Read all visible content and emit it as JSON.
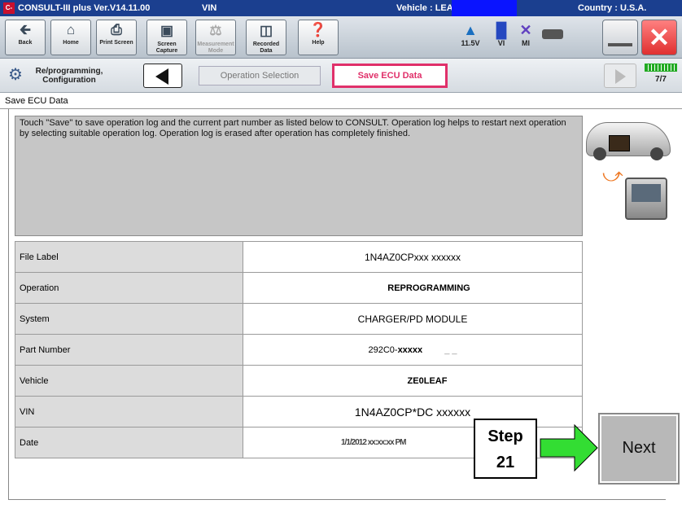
{
  "titlebar": {
    "logo": "C-III",
    "app": "CONSULT-III plus  Ver.V14.11.00",
    "vin_label": "VIN",
    "vehicle_label": "Vehicle : LEA",
    "country": "Country : U.S.A."
  },
  "toolbar": {
    "back": "Back",
    "home": "Home",
    "print_screen": "Print Screen",
    "screen_capture": "Screen Capture",
    "measurement_mode": "Measurement Mode",
    "recorded_data": "Recorded Data",
    "help": "Help",
    "voltage": "11.5V",
    "vi": "VI",
    "mi": "MI"
  },
  "nav": {
    "reprog": "Re/programming, Configuration",
    "operation_selection": "Operation Selection",
    "save_ecu_data": "Save ECU Data",
    "progress": "7/7"
  },
  "section_title": "Save ECU Data",
  "message": "Touch \"Save\" to save operation log and the current part number as listed below to CONSULT. Operation log helps to restart next operation by selecting suitable operation log. Operation log is erased after operation has completely finished.",
  "table": {
    "file_label": {
      "label": "File Label",
      "value": "1N4AZ0CPxxx xxxxxx"
    },
    "operation": {
      "label": "Operation",
      "value": "REPROGRAMMING"
    },
    "system": {
      "label": "System",
      "value": "CHARGER/PD MODULE"
    },
    "part_number": {
      "label": "Part Number",
      "value_prefix": "292C0-",
      "value_suffix": "xxxxx",
      "value_extra": "_ _"
    },
    "vehicle": {
      "label": "Vehicle",
      "value": "ZE0LEAF"
    },
    "vin": {
      "label": "VIN",
      "value": "1N4AZ0CP*DC xxxxxx"
    },
    "date": {
      "label": "Date",
      "value": "1/1/2012 xx:xx:xx PM"
    }
  },
  "step": {
    "label": "Step",
    "number": "21"
  },
  "next_button": "Next",
  "colors": {
    "titlebar": "#1b3f8f",
    "highlight": "#e0306a",
    "arrow": "#33dd33",
    "close": "#e03030"
  }
}
